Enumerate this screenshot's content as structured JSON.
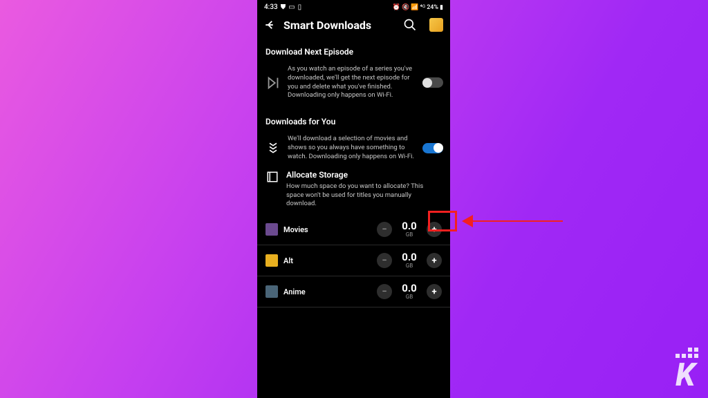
{
  "status": {
    "time": "4:33",
    "battery": "24%"
  },
  "header": {
    "title": "Smart Downloads"
  },
  "sections": {
    "next": {
      "title": "Download Next Episode",
      "desc": "As you watch an episode of a series you've downloaded, we'll get the next episode for you and delete what you've finished. Downloading only happens on Wi-Fi."
    },
    "foryou": {
      "title": "Downloads for You",
      "desc": "We'll download a selection of movies and shows so you always have something to watch. Downloading only happens on Wi-Fi."
    },
    "allocate": {
      "title": "Allocate Storage",
      "desc": "How much space do you want to allocate? This space won't be used for titles you manually download."
    }
  },
  "storage": [
    {
      "label": "Movies",
      "value": "0.0",
      "unit": "GB",
      "color": "#6b4a8f"
    },
    {
      "label": "Alt",
      "value": "0.0",
      "unit": "GB",
      "color": "#e8b020"
    },
    {
      "label": "Anime",
      "value": "0.0",
      "unit": "GB",
      "color": "#4a6578"
    }
  ],
  "watermark": "K"
}
